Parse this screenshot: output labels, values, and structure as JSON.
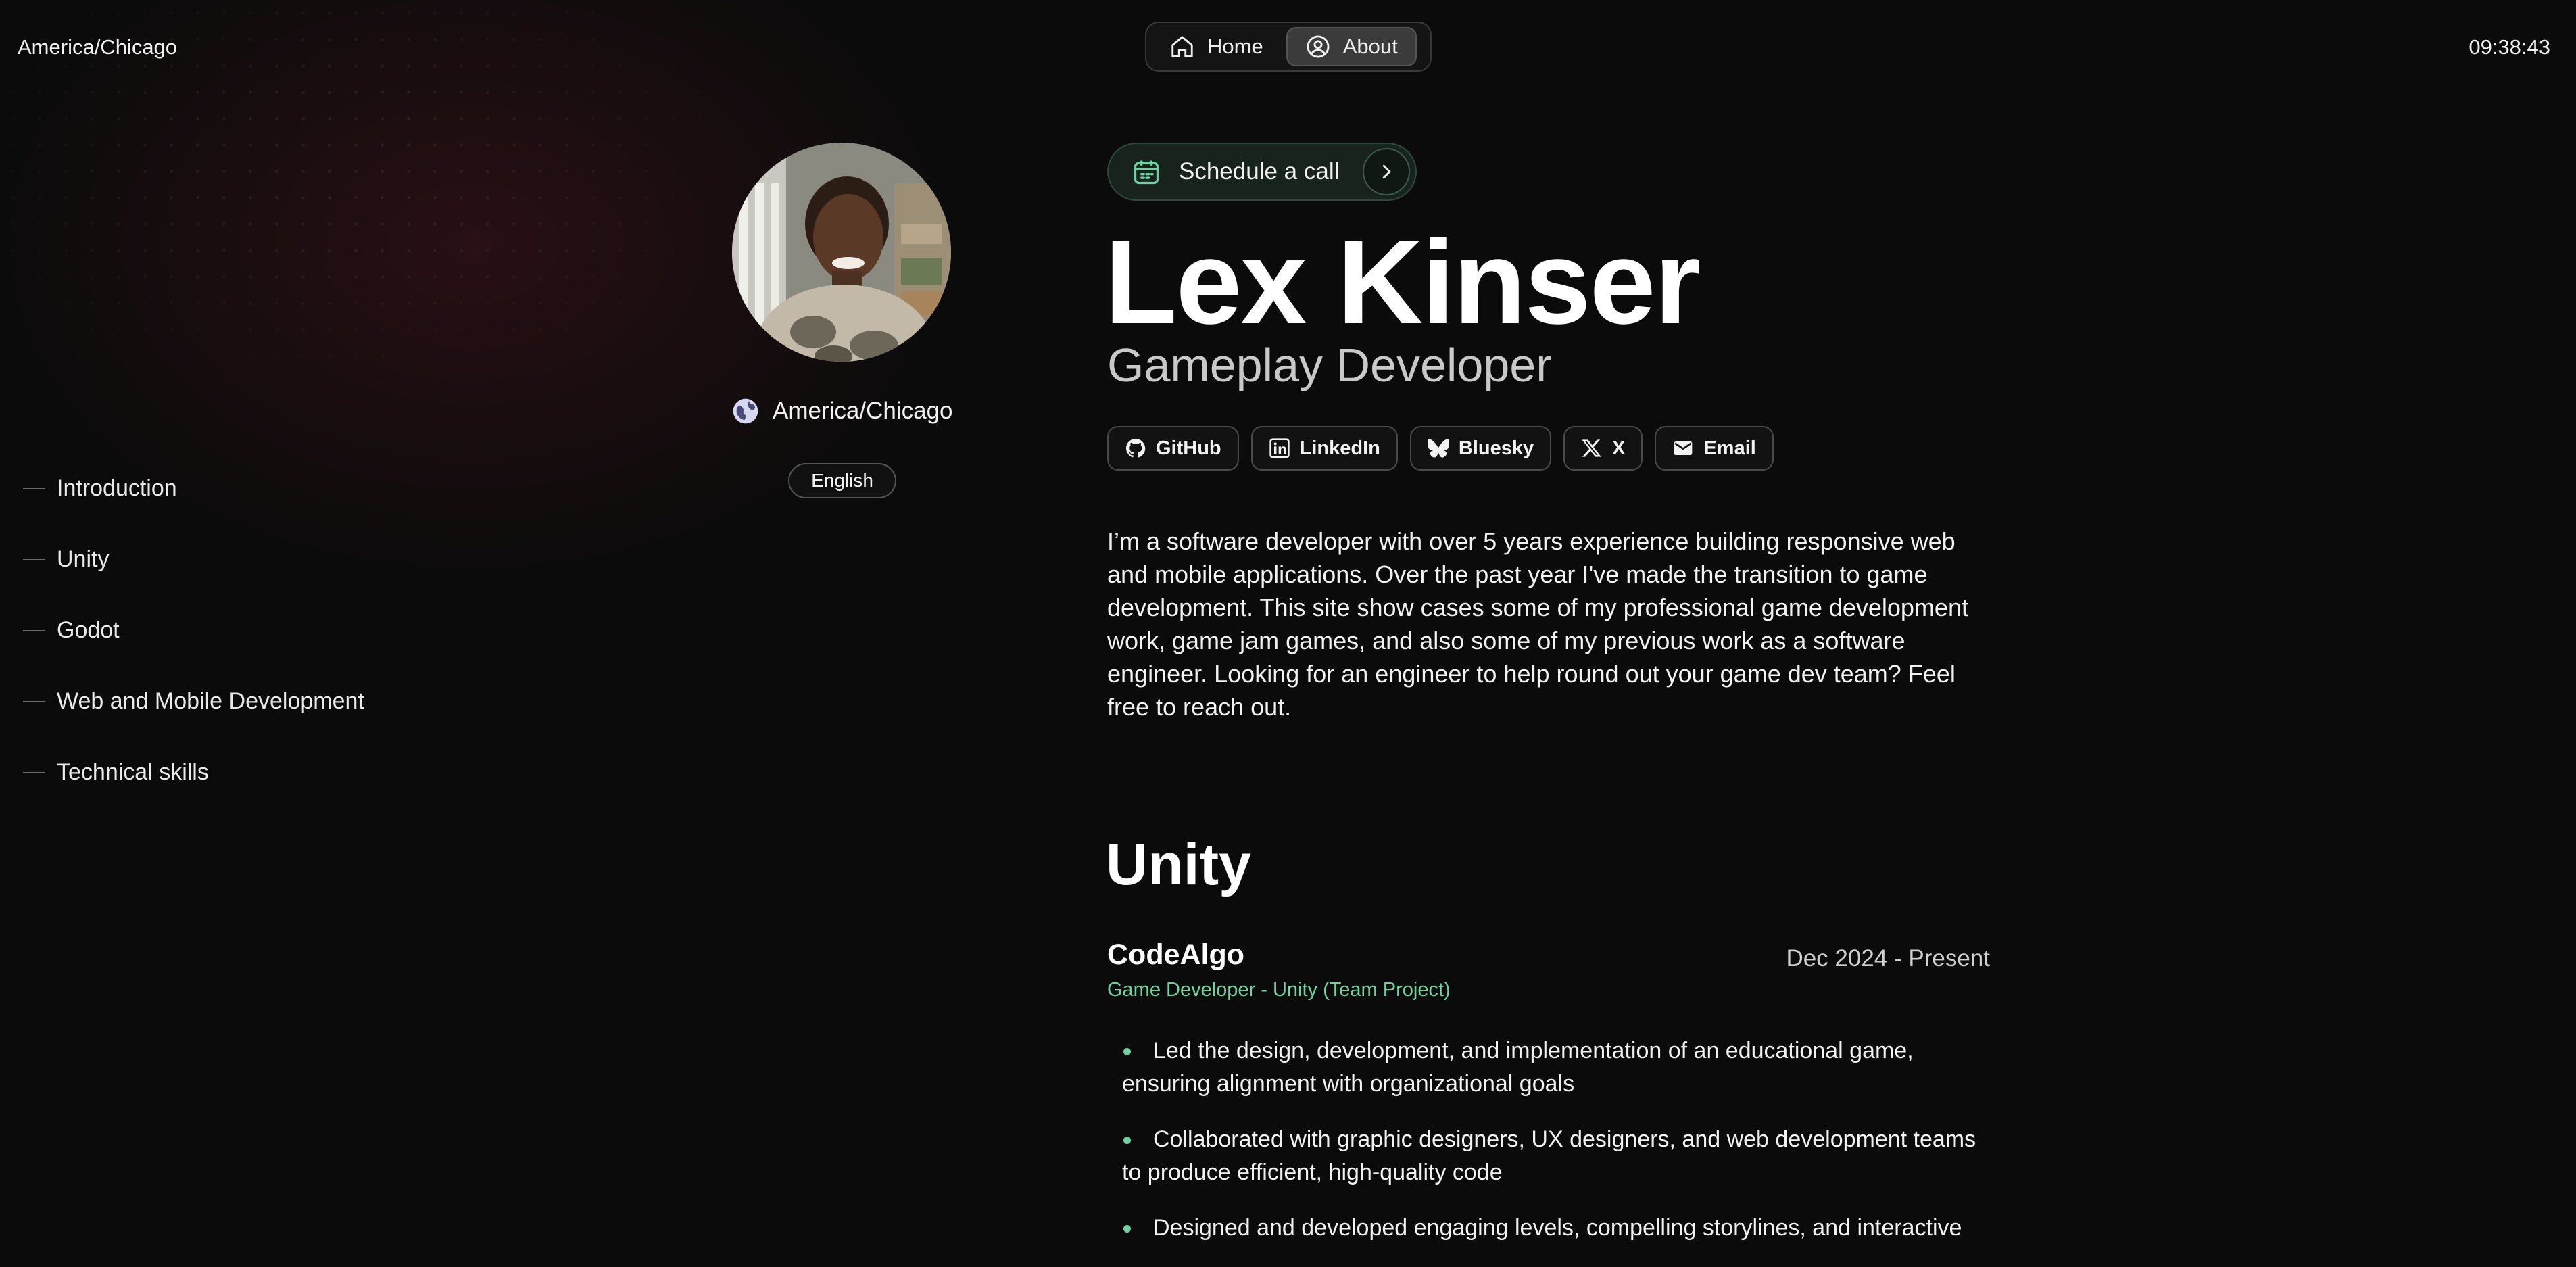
{
  "topbar": {
    "timezone": "America/Chicago",
    "clock": "09:38:43"
  },
  "nav": {
    "home_label": "Home",
    "about_label": "About",
    "active": "About"
  },
  "toc": [
    {
      "label": "Introduction"
    },
    {
      "label": "Unity"
    },
    {
      "label": "Godot"
    },
    {
      "label": "Web and Mobile Development"
    },
    {
      "label": "Technical skills"
    }
  ],
  "profile": {
    "location": "America/Chicago",
    "language": "English",
    "schedule_label": "Schedule a call",
    "name": "Lex Kinser",
    "role": "Gameplay Developer",
    "socials": [
      {
        "label": "GitHub",
        "icon": "github-icon"
      },
      {
        "label": "LinkedIn",
        "icon": "linkedin-icon"
      },
      {
        "label": "Bluesky",
        "icon": "bluesky-icon"
      },
      {
        "label": "X",
        "icon": "x-icon"
      },
      {
        "label": "Email",
        "icon": "email-icon"
      }
    ],
    "bio": "I’m a software developer with over 5 years experience building responsive web and mobile applications. Over the past year I've made the transition to game development. This site show cases some of my professional game development work, game jam games, and also some of my previous work as a software engineer. Looking for an engineer to help round out your game dev team? Feel free to reach out."
  },
  "unity": {
    "title": "Unity",
    "company": "CodeAlgo",
    "dates": "Dec 2024 - Present",
    "subtitle": "Game Developer - Unity (Team Project)",
    "bullets": [
      "Led the design, development, and implementation of an educational game, ensuring alignment with organizational goals",
      "Collaborated with graphic designers, UX designers, and web development teams to produce efficient, high-quality code",
      "Designed and developed engaging levels, compelling storylines, and interactive"
    ]
  },
  "colors": {
    "accent": "#6fd3a0",
    "background": "#0c0b0b",
    "glow": "#501620"
  }
}
